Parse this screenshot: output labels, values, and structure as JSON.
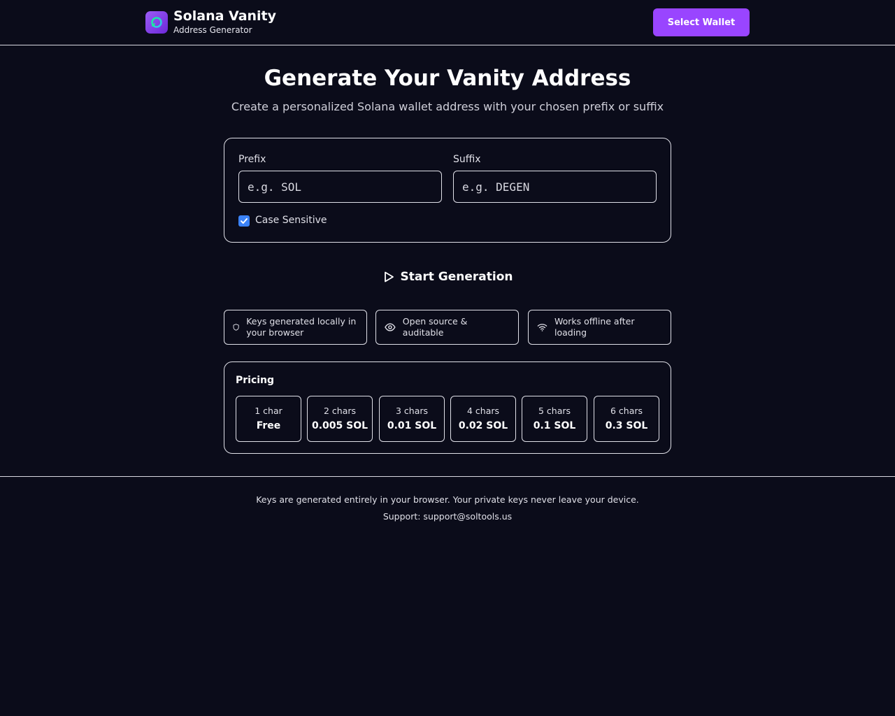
{
  "header": {
    "title": "Solana Vanity",
    "subtitle": "Address Generator",
    "wallet_button": "Select Wallet",
    "logo_icon": "solana-logo-icon"
  },
  "main": {
    "title": "Generate Your Vanity Address",
    "subtitle": "Create a personalized Solana wallet address with your chosen prefix or suffix"
  },
  "form": {
    "prefix_label": "Prefix",
    "prefix_placeholder": "e.g. SOL",
    "prefix_value": "",
    "suffix_label": "Suffix",
    "suffix_placeholder": "e.g. DEGEN",
    "suffix_value": "",
    "case_sensitive_label": "Case Sensitive",
    "case_sensitive_checked": true
  },
  "start_button": {
    "label": "Start Generation",
    "icon": "play-icon"
  },
  "features": [
    {
      "icon": "shield-icon",
      "text": "Keys generated locally in your browser"
    },
    {
      "icon": "eye-icon",
      "text": "Open source & auditable"
    },
    {
      "icon": "wifi-icon",
      "text": "Works offline after loading"
    }
  ],
  "pricing": {
    "title": "Pricing",
    "tiers": [
      {
        "chars": "1 char",
        "price": "Free"
      },
      {
        "chars": "2 chars",
        "price": "0.005 SOL"
      },
      {
        "chars": "3 chars",
        "price": "0.01 SOL"
      },
      {
        "chars": "4 chars",
        "price": "0.02 SOL"
      },
      {
        "chars": "5 chars",
        "price": "0.1 SOL"
      },
      {
        "chars": "6 chars",
        "price": "0.3 SOL"
      }
    ]
  },
  "footer": {
    "line1": "Keys are generated entirely in your browser. Your private keys never leave your device.",
    "line2": "Support: support@soltools.us"
  },
  "colors": {
    "background": "#0b0c1a",
    "accent": "#9945ff",
    "checkbox": "#3b82f6"
  }
}
